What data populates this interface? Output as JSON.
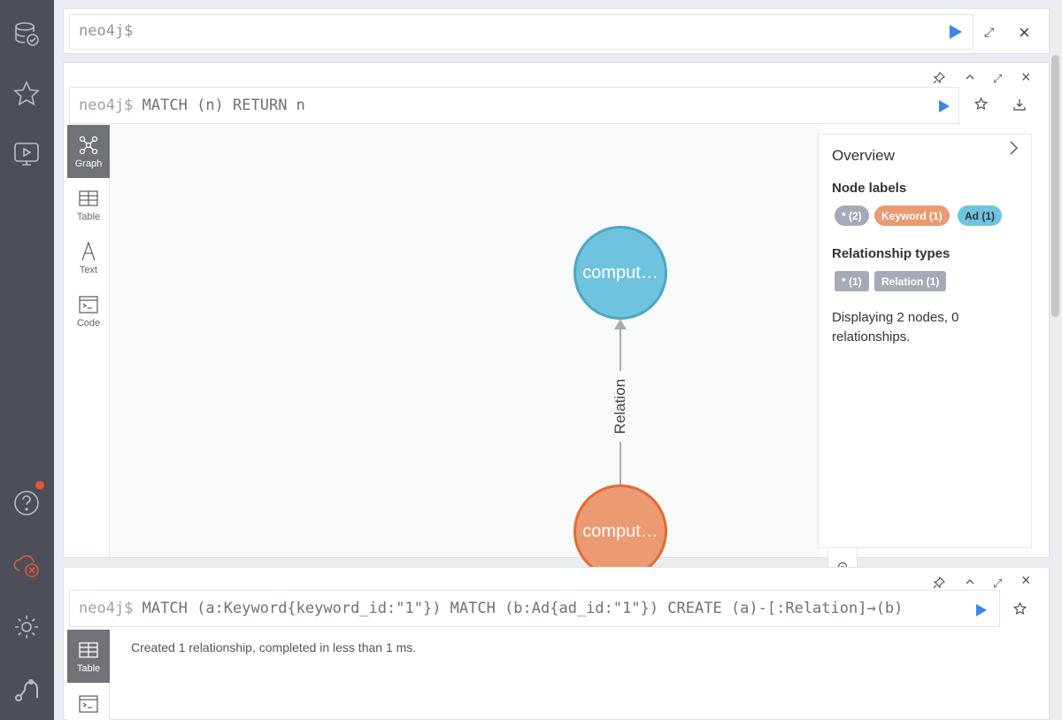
{
  "sidebar": {
    "items": [
      {
        "name": "database-icon"
      },
      {
        "name": "favorites-star-icon"
      },
      {
        "name": "guides-monitor-icon"
      },
      {
        "name": "help-icon"
      },
      {
        "name": "cloud-disconnected-icon"
      },
      {
        "name": "settings-gear-icon"
      },
      {
        "name": "neo4j-logo-icon"
      }
    ]
  },
  "topbar": {
    "prompt": "neo4j$"
  },
  "frame1": {
    "prompt": "neo4j$",
    "query": "MATCH (n) RETURN n",
    "tabs": [
      {
        "label": "Graph"
      },
      {
        "label": "Table"
      },
      {
        "label": "Text"
      },
      {
        "label": "Code"
      }
    ],
    "graph": {
      "node_ad": {
        "caption": "comput…",
        "color": "#6fc3df"
      },
      "node_keyword": {
        "caption": "comput…",
        "color": "#eb9a71"
      },
      "edge": {
        "label": "Relation"
      }
    },
    "overview": {
      "title": "Overview",
      "node_labels_heading": "Node labels",
      "node_labels": [
        "* (2)",
        "Keyword (1)",
        "Ad (1)"
      ],
      "rel_types_heading": "Relationship types",
      "rel_types": [
        "* (1)",
        "Relation (1)"
      ],
      "summary": "Displaying 2 nodes, 0 relationships."
    }
  },
  "frame2": {
    "prompt": "neo4j$",
    "query": "MATCH (a:Keyword{keyword_id:\"1\"}) MATCH (b:Ad{ad_id:\"1\"}) CREATE (a)-[:Relation]→(b)",
    "tabs": [
      {
        "label": "Table"
      }
    ],
    "result": "Created 1 relationship, completed in less than 1 ms."
  },
  "colors": {
    "sidebar_bg": "#4c4f57",
    "play_blue": "#3b86ee",
    "notification_red": "#e2543c"
  }
}
